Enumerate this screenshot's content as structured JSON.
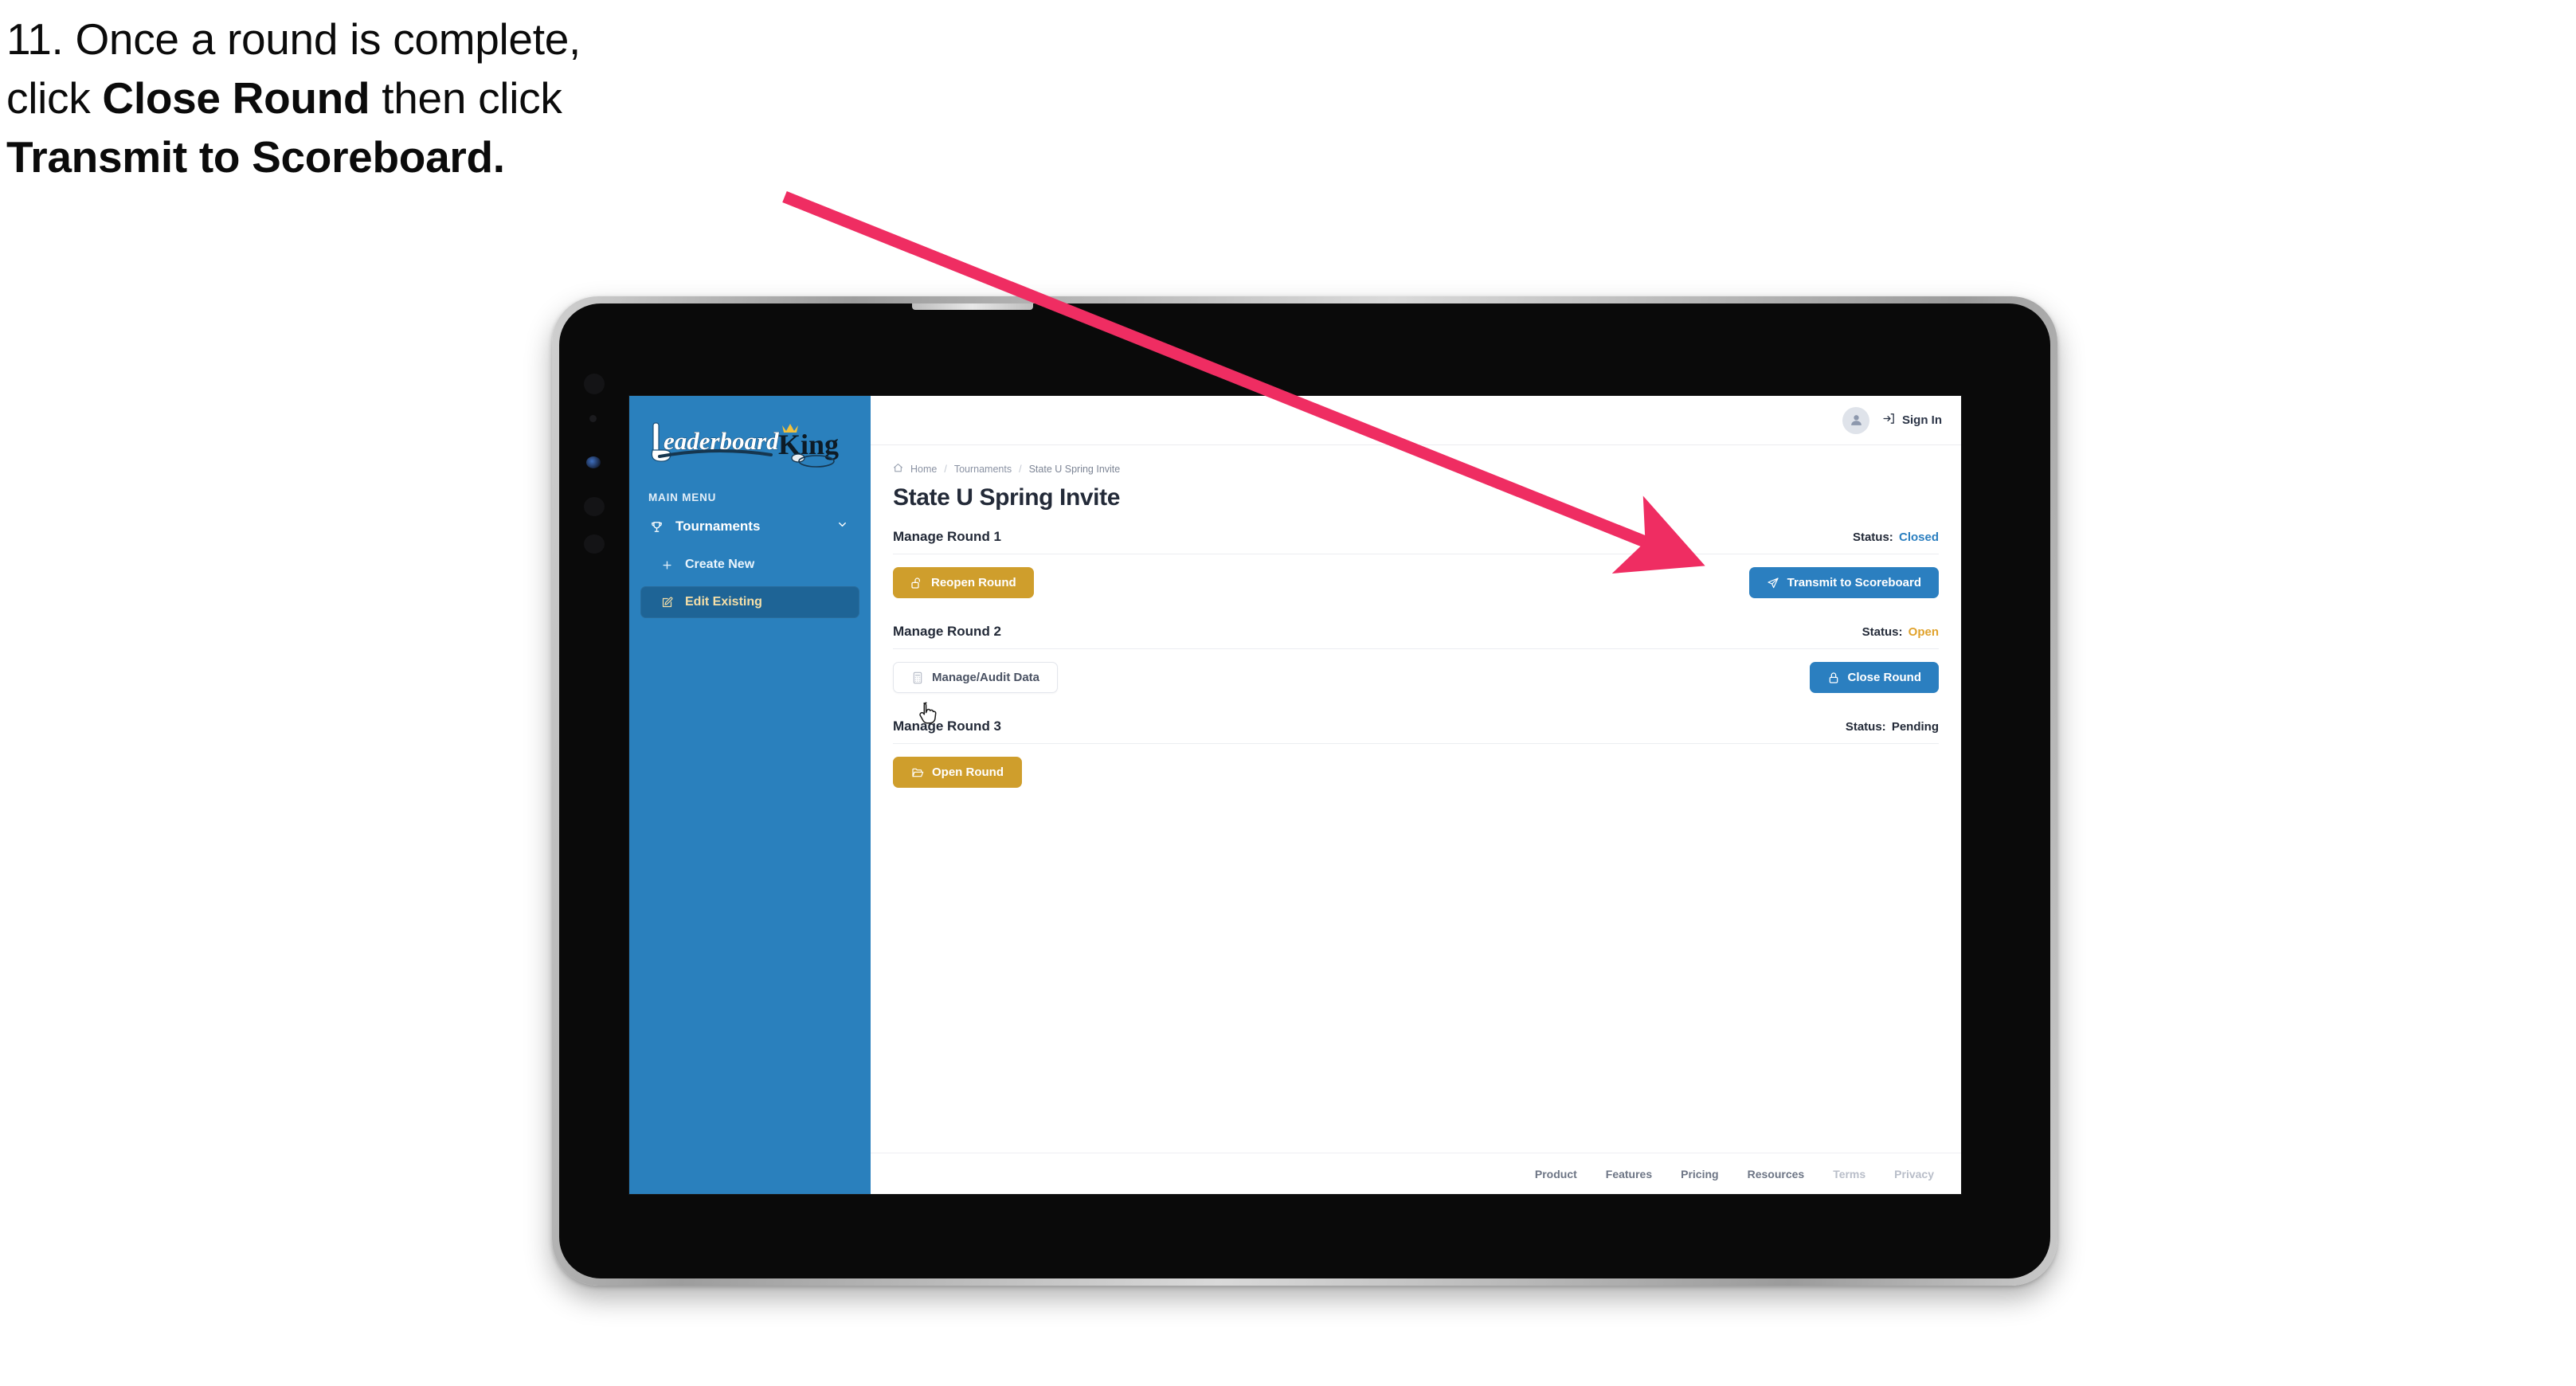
{
  "caption": {
    "line1_plain": "11. Once a round is complete,",
    "line2_a": "click ",
    "line2_b": "Close Round",
    "line2_c": " then click",
    "line3_b": "Transmit to Scoreboard."
  },
  "colors": {
    "annotation_arrow": "#ef2d62",
    "sidebar_blue": "#2a80bd",
    "sidebar_active": "#1e6496",
    "sidebar_active_text": "#f5dfa8",
    "button_gold": "#cf9e2c",
    "button_blue": "#2b7fc0",
    "status_closed": "#2b7fc0",
    "status_open": "#e0a22c",
    "status_pending": "#232a38",
    "logo_crown": "#f2c13c"
  },
  "sidebar": {
    "logo_primary": "Leaderboard",
    "logo_secondary": "King",
    "section_label": "MAIN MENU",
    "items": [
      {
        "label": "Tournaments",
        "icon": "trophy-icon",
        "chevron": "chevron-down-icon",
        "active": false
      },
      {
        "label": "Create New",
        "icon": "plus-icon",
        "active": false
      },
      {
        "label": "Edit Existing",
        "icon": "pencil-square-icon",
        "active": true
      }
    ]
  },
  "topbar": {
    "avatar_icon": "user-avatar-icon",
    "signin_icon": "sign-in-arrow-icon",
    "signin_label": "Sign In"
  },
  "breadcrumb": {
    "home_icon": "home-icon",
    "items": [
      "Home",
      "Tournaments",
      "State U Spring Invite"
    ],
    "separator": "/"
  },
  "page": {
    "title": "State U Spring Invite"
  },
  "rounds": [
    {
      "name": "Manage Round 1",
      "status_label": "Status:",
      "status_value": "Closed",
      "status_color": "#2b7fc0",
      "left_button": {
        "label": "Reopen Round",
        "icon": "unlock-icon",
        "style": "gold"
      },
      "right_button": {
        "label": "Transmit to Scoreboard",
        "icon": "paper-plane-icon",
        "style": "blue"
      }
    },
    {
      "name": "Manage Round 2",
      "status_label": "Status:",
      "status_value": "Open",
      "status_color": "#e0a22c",
      "left_button": {
        "label": "Manage/Audit Data",
        "icon": "grid-table-icon",
        "style": "ghost"
      },
      "right_button": {
        "label": "Close Round",
        "icon": "lock-icon",
        "style": "blue"
      }
    },
    {
      "name": "Manage Round 3",
      "status_label": "Status:",
      "status_value": "Pending",
      "status_color": "#232a38",
      "left_button": {
        "label": "Open Round",
        "icon": "folder-open-icon",
        "style": "gold"
      },
      "right_button": null
    }
  ],
  "footer": {
    "links": [
      {
        "label": "Product",
        "dim": false
      },
      {
        "label": "Features",
        "dim": false
      },
      {
        "label": "Pricing",
        "dim": false
      },
      {
        "label": "Resources",
        "dim": false
      },
      {
        "label": "Terms",
        "dim": true
      },
      {
        "label": "Privacy",
        "dim": true
      }
    ]
  }
}
